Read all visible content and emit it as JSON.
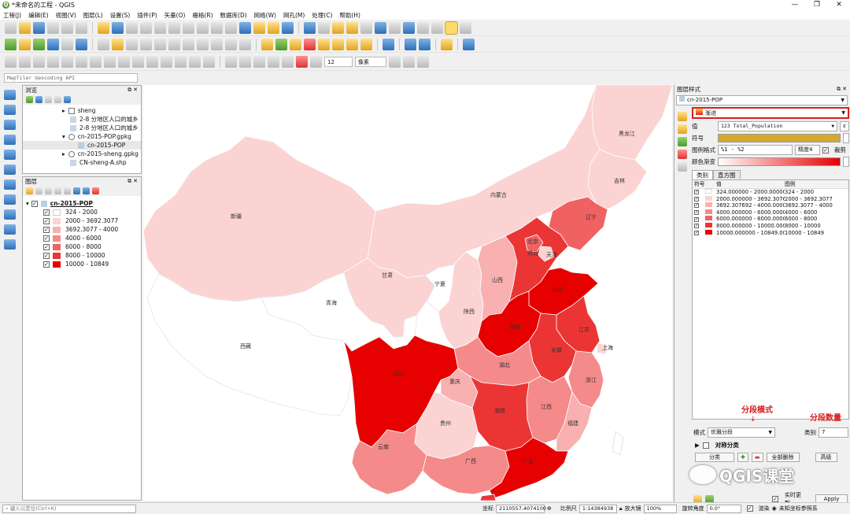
{
  "window": {
    "title": "*未命名的工程 - QGIS",
    "logo": "Q",
    "min": "—",
    "max": "❐",
    "close": "✕"
  },
  "menu": [
    "工程(J)",
    "编辑(E)",
    "视图(V)",
    "图层(L)",
    "设置(S)",
    "插件(P)",
    "矢量(O)",
    "栅格(R)",
    "数据库(D)",
    "网络(W)",
    "网孔(M)",
    "处理(C)",
    "帮助(H)"
  ],
  "toolbar3": {
    "size_value": "12",
    "unit_value": "像素"
  },
  "geocoder": {
    "placeholder": "MapTiler Geocoding API"
  },
  "browser": {
    "title": "浏览",
    "items": [
      {
        "label": "sheng",
        "indent": 60
      },
      {
        "label": "2-8  分地区人口的城乡",
        "indent": 60
      },
      {
        "label": "2-8  分地区人口的城乡",
        "indent": 60
      },
      {
        "label": "cn-2015-POP.gpkg",
        "indent": 50
      },
      {
        "label": "cn-2015-POP",
        "indent": 70
      },
      {
        "label": "cn-2015-sheng.gpkg",
        "indent": 50
      },
      {
        "label": "CN-sheng-A.shp",
        "indent": 50
      }
    ]
  },
  "layers": {
    "title": "图层",
    "layer_name": "cn-2015-POP",
    "legend": [
      {
        "label": "324 - 2000",
        "color": "#ffffff"
      },
      {
        "label": "2000 - 3692.3077",
        "color": "#fbd3d3"
      },
      {
        "label": "3692.3077 - 4000",
        "color": "#f8b0b0"
      },
      {
        "label": "4000 - 6000",
        "color": "#f58a8a"
      },
      {
        "label": "6000 - 8000",
        "color": "#f06262"
      },
      {
        "label": "8000 - 10000",
        "color": "#eb3535"
      },
      {
        "label": "10000 - 10849",
        "color": "#e60000"
      }
    ]
  },
  "map": {
    "labels": {
      "heilongjiang": "黑龙江",
      "jilin": "吉林",
      "liaoning": "辽宁",
      "neimenggu": "内蒙古",
      "beijing": "北京",
      "tianjin": "天津",
      "hebei": "河北",
      "shanxi": "山西",
      "xinjiang": "新疆",
      "gansu": "甘肃",
      "ningxia": "宁夏",
      "qinghai": "青海",
      "shaanxi": "陕西",
      "shandong": "山东",
      "henan": "河南",
      "jiangsu": "江苏",
      "shanghai": "上海",
      "anhui": "安徽",
      "xizang": "西藏",
      "sichuan": "四川",
      "hubei": "湖北",
      "chongqing": "重庆",
      "zhejiang": "浙江",
      "hunan": "湖南",
      "jiangxi": "江西",
      "guizhou": "贵州",
      "fujian": "福建",
      "yunnan": "云南",
      "guangxi": "广西",
      "guangdong": "广东"
    }
  },
  "style_panel": {
    "title": "图层样式",
    "layer_select": "cn-2015-POP",
    "renderer": "渐进",
    "value_label": "值",
    "value_field": "123 Total_Population",
    "symbol_label": "符号",
    "symbol_color": "#d4a92e",
    "format_label": "图例格式",
    "format_value": "%1 - %2",
    "precision_label": "精度4",
    "trim_label": "裁剪",
    "ramp_label": "颜色渐变",
    "tab_classes": "类别",
    "tab_histogram": "直方图",
    "col_symbol": "符号",
    "col_value": "值",
    "col_legend": "图例",
    "classes": [
      {
        "value": "324.000000 - 2000.000000",
        "legend": "324 - 2000",
        "color": "#ffffff"
      },
      {
        "value": "2000.000000 - 3692.307692",
        "legend": "2000 - 3692.3077",
        "color": "#fbd3d3"
      },
      {
        "value": "3692.307692 - 4000.000000",
        "legend": "3692.3077 - 4000",
        "color": "#f8b0b0"
      },
      {
        "value": "4000.000000 - 6000.000000",
        "legend": "4000 - 6000",
        "color": "#f58a8a"
      },
      {
        "value": "6000.000000 - 8000.000000",
        "legend": "6000 - 8000",
        "color": "#f06262"
      },
      {
        "value": "8000.000000 - 10000.000000",
        "legend": "8000 - 10000",
        "color": "#eb3535"
      },
      {
        "value": "10000.000000 - 10849.000000",
        "legend": "10000 - 10849",
        "color": "#e60000"
      }
    ],
    "annot_mode": "分段模式",
    "annot_count": "分段数量",
    "mode_label": "模式",
    "mode_value": "优雅分段",
    "classes_label": "类别",
    "classes_count": "7",
    "symmetric_label": "对称分类",
    "classify_btn": "分类",
    "delete_all_btn": "全部删除",
    "advanced_btn": "高级",
    "live_update": "实时更新",
    "apply_btn": "Apply"
  },
  "statusbar": {
    "locate_placeholder": "键入以定位(Ctrl+K)",
    "coord_label": "坐标",
    "coord_value": "2110557,4074100",
    "scale_label": "比例尺",
    "scale_value": "1:14384938",
    "magnifier_label": "放大镜",
    "magnifier_value": "100%",
    "rotation_label": "旋转角度",
    "rotation_value": "0.0°",
    "render_label": "渲染",
    "crs_label": "未知坐标参照系"
  },
  "watermark": {
    "text": "QGIS课堂"
  }
}
